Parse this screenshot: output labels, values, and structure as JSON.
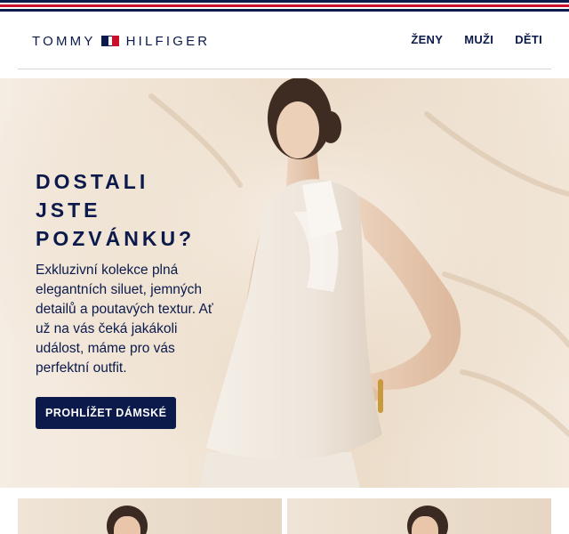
{
  "brand": {
    "logo_left": "TOMMY",
    "logo_right": "HILFIGER",
    "flag_icon": "tommy-flag-icon",
    "colors": {
      "navy": "#0b1a4b",
      "red": "#c8102e",
      "white": "#ffffff"
    }
  },
  "nav": {
    "items": [
      {
        "label": "ŽENY"
      },
      {
        "label": "MUŽI"
      },
      {
        "label": "DĚTI"
      }
    ]
  },
  "hero": {
    "title_lines": [
      "DOSTALI",
      "JSTE",
      "POZVÁNKU?"
    ],
    "text": "Exkluzivní kolekce plná elegantních siluet, jemných detailů a poutavých textur. Ať už na vás čeká jakákoli událost, máme pro vás perfektní outfit.",
    "cta_label": "PROHLÍŽET DÁMSKÉ",
    "image": "model-white-halter-top-photo"
  },
  "bottom_images": [
    "model-photo-left",
    "model-photo-right"
  ]
}
